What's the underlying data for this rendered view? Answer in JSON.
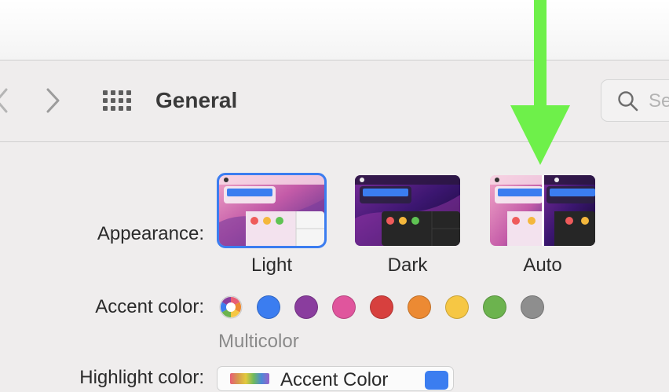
{
  "toolbar": {
    "title": "General",
    "search_placeholder": "Se"
  },
  "appearance": {
    "label": "Appearance:",
    "options": [
      {
        "label": "Light",
        "selected": true
      },
      {
        "label": "Dark",
        "selected": false
      },
      {
        "label": "Auto",
        "selected": false
      }
    ]
  },
  "accent": {
    "label": "Accent color:",
    "selected_name": "Multicolor",
    "colors": [
      "#3b7df0",
      "#8a3d9e",
      "#e0559d",
      "#d7403e",
      "#ec8a33",
      "#f6c744",
      "#6cb34e",
      "#8e8e8e"
    ]
  },
  "highlight": {
    "label": "Highlight color:",
    "value": "Accent Color"
  },
  "overlay": {
    "arrow_color": "#6ef04a"
  }
}
